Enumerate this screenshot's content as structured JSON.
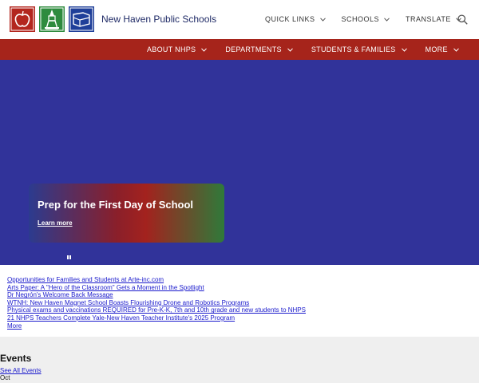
{
  "header": {
    "site_name": "New Haven Public Schools",
    "utility_nav": [
      {
        "label": "QUICK LINKS"
      },
      {
        "label": "SCHOOLS"
      },
      {
        "label": "TRANSLATE"
      }
    ],
    "logos": [
      "apple-icon",
      "building-icon",
      "book-icon"
    ],
    "colors": {
      "logo_red": "#b3261e",
      "logo_green": "#2e8b3e",
      "logo_blue": "#1f3f99"
    }
  },
  "main_nav": {
    "items": [
      {
        "label": "ABOUT NHPS"
      },
      {
        "label": "DEPARTMENTS"
      },
      {
        "label": "STUDENTS & FAMILIES"
      },
      {
        "label": "MORE"
      }
    ],
    "color": "#a6241b"
  },
  "hero": {
    "title": "Prep for the First Day of School",
    "link_label": "Learn more",
    "background": "#31339a"
  },
  "news": {
    "items": [
      "Opportunities for Families and Students at Arte-inc.com",
      "Arts Paper: A \"Hero of the Classroom\" Gets a Moment in the Spotlight",
      "Dr Negrón's Welcome Back Message",
      "WTNH: New Haven Magnet School Boasts Flourishing Drone and Robotics Programs",
      "Physical exams and vaccinations REQUIRED for Pre-K-K, 7th and 10th grade and new students to NHPS",
      "21 NHPS Teachers Complete Yale-New Haven Teacher Institute's 2025 Program"
    ],
    "more_label": "More"
  },
  "events": {
    "title": "Events",
    "see_all_label": "See All Events",
    "month": "Oct"
  }
}
